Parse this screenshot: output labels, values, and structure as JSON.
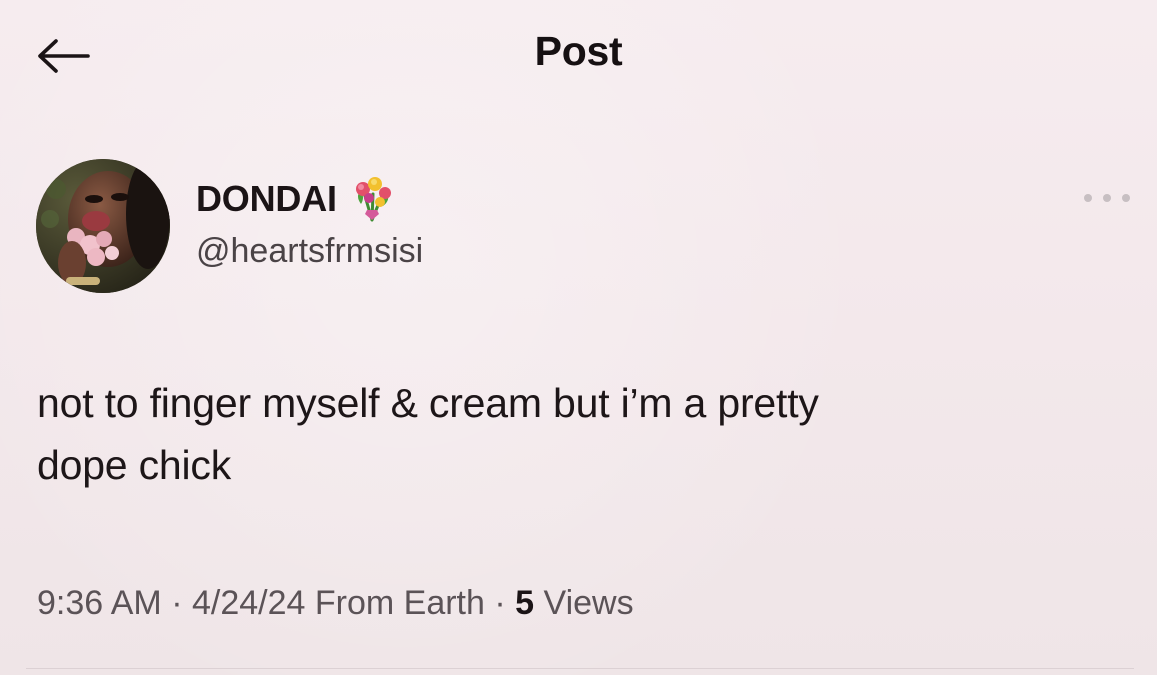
{
  "header": {
    "back_icon": "arrow-left-icon",
    "title": "Post"
  },
  "author": {
    "display_name": "DONDAI",
    "name_emoji_icon": "bouquet-icon",
    "handle": "@heartsfrmsisi",
    "avatar_icon": "profile-photo",
    "more_icon": "more-horizontal-icon"
  },
  "post": {
    "text_line1": "not to finger myself & cream but i’m a pretty",
    "text_line2": "dope chick"
  },
  "meta": {
    "time": "9:36 AM",
    "separator": " · ",
    "date": "4/24/24",
    "source": "From Earth",
    "views_count": "5",
    "views_label": "Views"
  },
  "colors": {
    "background": "#f4eaec",
    "text_primary": "#1b1416",
    "text_secondary": "#5b5357"
  }
}
